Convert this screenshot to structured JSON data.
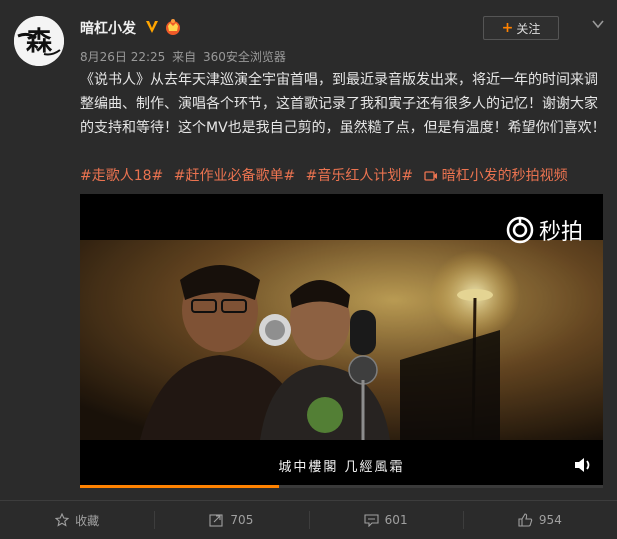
{
  "user": {
    "name": "暗杠小发",
    "avatar_glyph": "森",
    "verified_icon": "verified-v-icon",
    "member_icon": "member-crown-icon"
  },
  "meta": {
    "date": "8月26日 22:25",
    "source_prefix": "来自",
    "source": "360安全浏览器"
  },
  "follow": {
    "plus": "+",
    "label": "关注"
  },
  "post": {
    "text": "《说书人》从去年天津巡演全宇宙首唱，到最近录音版发出来，将近一年的时间来调整编曲、制作、演唱各个环节，这首歌记录了我和寅子还有很多人的记忆！谢谢大家的支持和等待！这个MV也是我自己剪的，虽然糙了点，但是有温度！希望你们喜欢！",
    "tags": [
      "#走歌人18#",
      "#赶作业必备歌单#",
      "#音乐红人计划#"
    ],
    "video_link": "暗杠小发的秒拍视频"
  },
  "video": {
    "logo_text": "秒拍",
    "subtitle": "城中樓閣 几經風霜",
    "progress": 0.38
  },
  "footer": {
    "favorite": "收藏",
    "repost": "705",
    "comment": "601",
    "like": "954"
  },
  "colors": {
    "accent": "#ff8200",
    "tag": "#eb7350",
    "background": "#2b2b2b"
  }
}
